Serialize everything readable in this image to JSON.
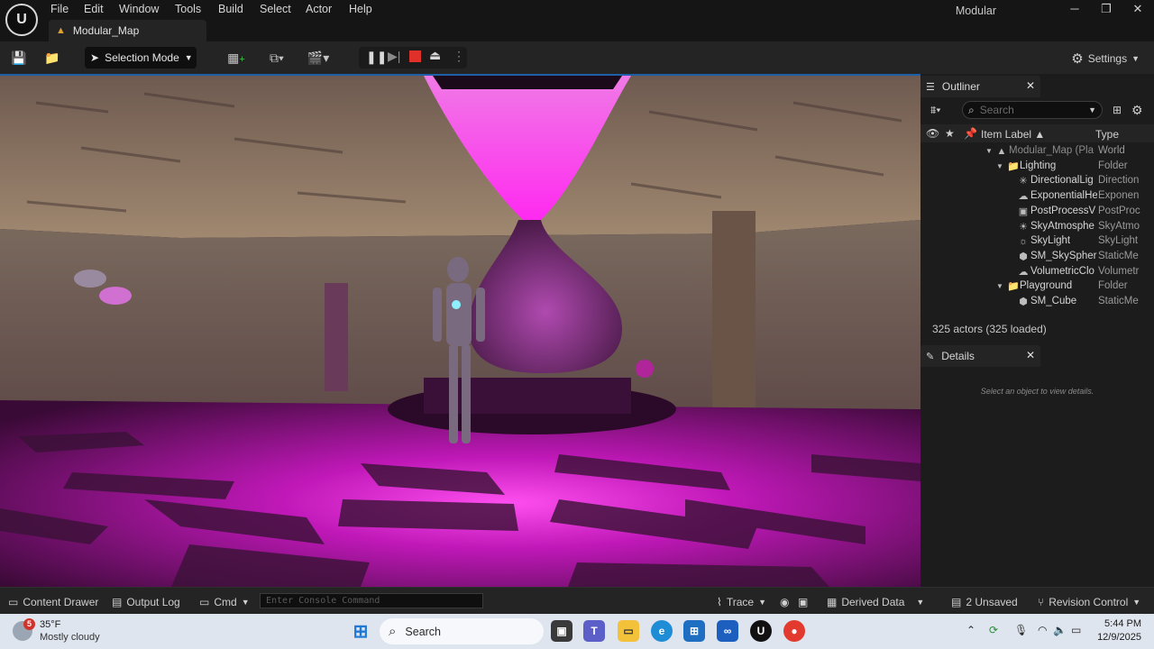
{
  "menu": [
    "File",
    "Edit",
    "Window",
    "Tools",
    "Build",
    "Select",
    "Actor",
    "Help"
  ],
  "app_name": "Modular",
  "window_controls": {
    "minimize": "─",
    "restore": "❐",
    "close": "✕"
  },
  "document_tab": "Modular_Map",
  "toolbar": {
    "selection_mode": "Selection Mode",
    "settings": "Settings"
  },
  "outliner": {
    "tab": "Outliner",
    "search_placeholder": "Search",
    "col_label": "Item Label ▲",
    "col_type": "Type",
    "rows": [
      {
        "label": "Modular_Map (Pla",
        "type": "World",
        "icon": "▲",
        "depth": 0
      },
      {
        "label": "Lighting",
        "type": "Folder",
        "icon": "📁",
        "depth": 1
      },
      {
        "label": "DirectionalLig",
        "type": "Direction",
        "icon": "✳",
        "depth": 2
      },
      {
        "label": "ExponentialHe",
        "type": "Exponen",
        "icon": "☁",
        "depth": 2
      },
      {
        "label": "PostProcessV",
        "type": "PostProc",
        "icon": "▣",
        "depth": 2
      },
      {
        "label": "SkyAtmosphe",
        "type": "SkyAtmo",
        "icon": "☀",
        "depth": 2
      },
      {
        "label": "SkyLight",
        "type": "SkyLight",
        "icon": "☼",
        "depth": 2
      },
      {
        "label": "SM_SkySphere",
        "type": "StaticMe",
        "icon": "⬢",
        "depth": 2
      },
      {
        "label": "VolumetricClo",
        "type": "Volumetr",
        "icon": "☁",
        "depth": 2
      },
      {
        "label": "Playground",
        "type": "Folder",
        "icon": "📁",
        "depth": 1
      },
      {
        "label": "SM_Cube",
        "type": "StaticMe",
        "icon": "⬢",
        "depth": 2
      }
    ],
    "actors_count": "325 actors (325 loaded)"
  },
  "details": {
    "tab": "Details",
    "hint": "Select an object to view details."
  },
  "statusbar": {
    "content_drawer": "Content Drawer",
    "output_log": "Output Log",
    "cmd": "Cmd",
    "console_placeholder": "Enter Console Command",
    "trace": "Trace",
    "derived_data": "Derived Data",
    "unsaved": "2 Unsaved",
    "revision_control": "Revision Control"
  },
  "taskbar": {
    "weather_temp": "35°F",
    "weather_desc": "Mostly cloudy",
    "weather_badge": "5",
    "search": "Search",
    "time": "5:44 PM",
    "date": "12/9/2025"
  },
  "colors": {
    "accent": "#1e5fa8",
    "scene_magenta": "#e020d8",
    "record": "#e0302a"
  }
}
